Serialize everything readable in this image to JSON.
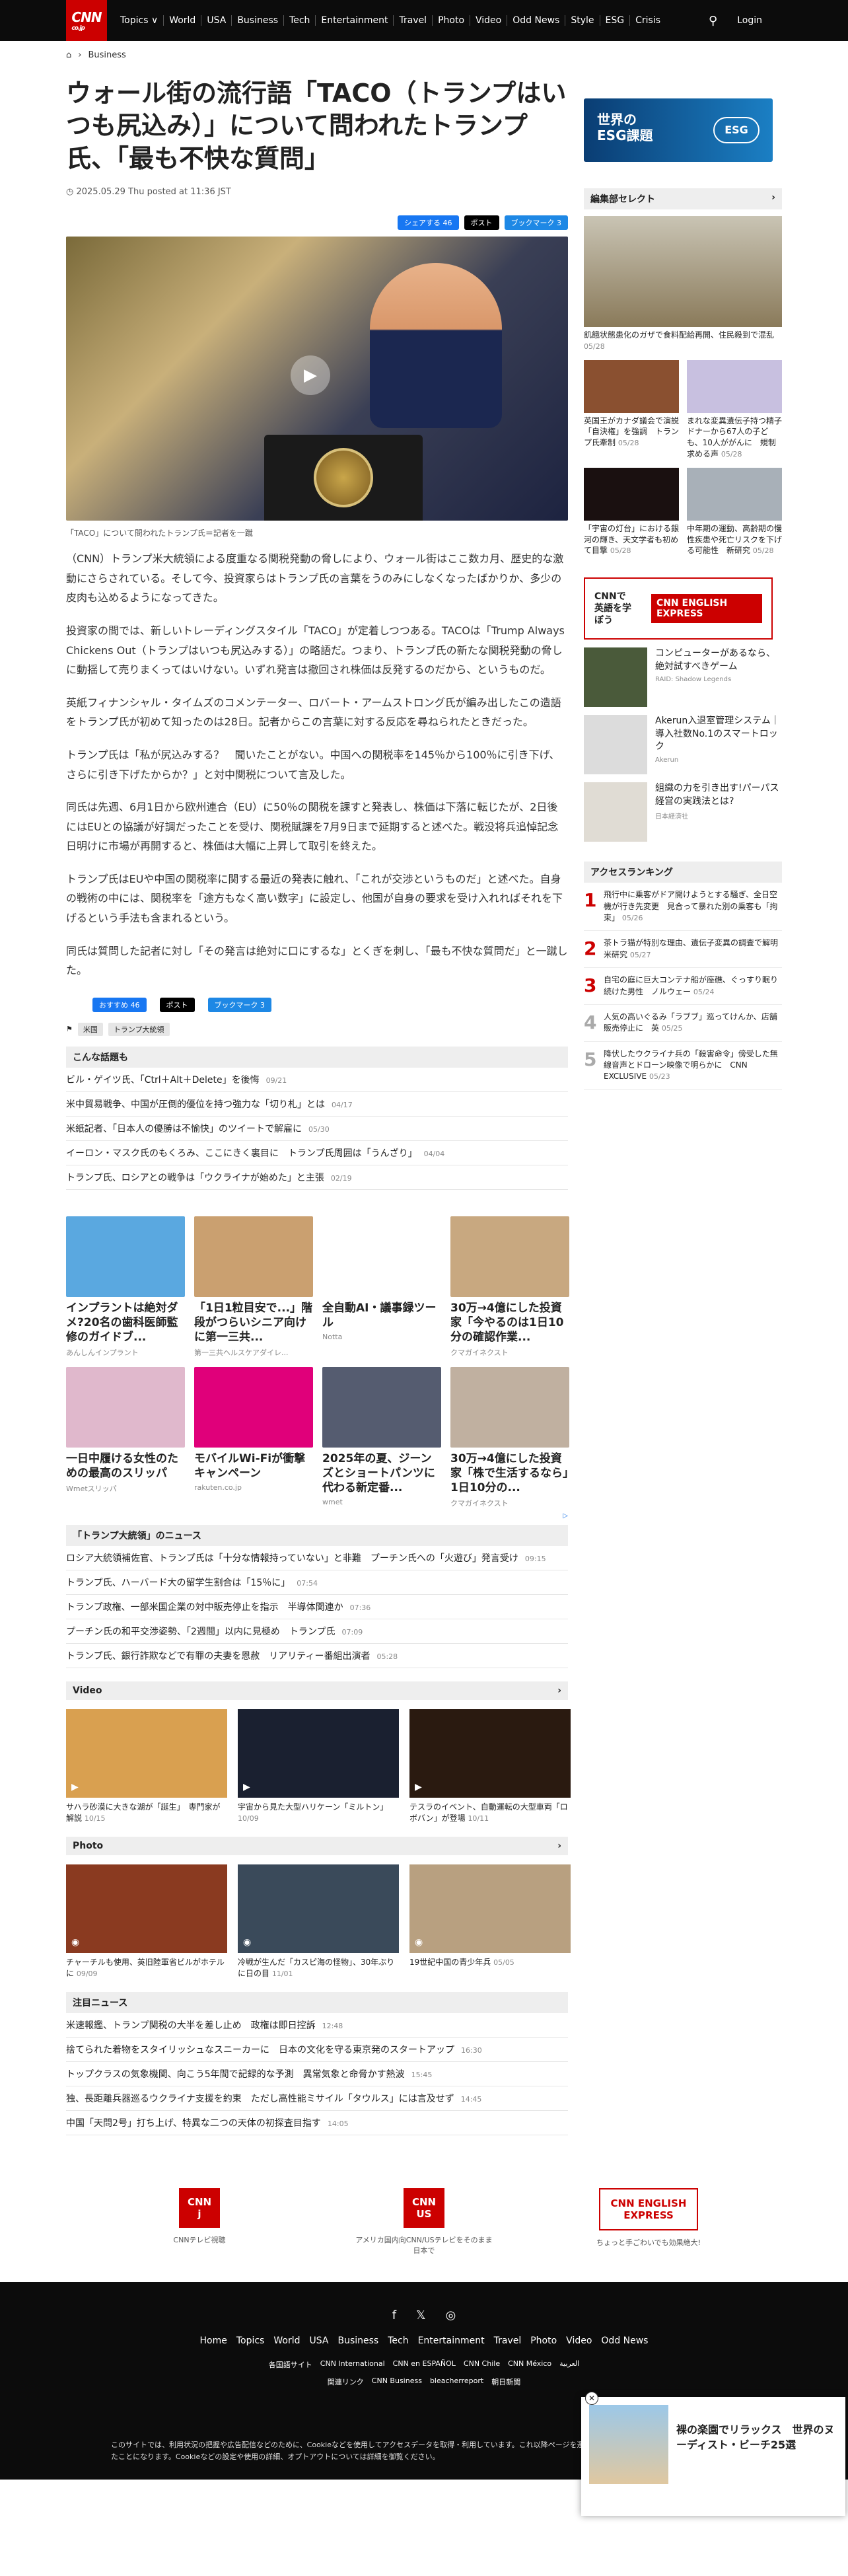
{
  "header": {
    "logo": "CNN",
    "logo_sub": "co.jp",
    "nav": [
      "Topics ∨",
      "World",
      "USA",
      "Business",
      "Tech",
      "Entertainment",
      "Travel",
      "Photo",
      "Video",
      "Odd News",
      "Style",
      "ESG",
      "Crisis"
    ],
    "login": "Login"
  },
  "breadcrumb": {
    "home": "⌂",
    "sep": "›",
    "section": "Business"
  },
  "article": {
    "title": "ウォール街の流行語「TACO（トランプはいつも尻込み）」について問われたトランプ氏、「最も不快な質問」",
    "date": "2025.05.29 Thu posted at 11:36 JST",
    "share": {
      "fb": "シェアする 46",
      "x": "ポスト",
      "hb": "ブックマーク 3"
    },
    "caption": "「TACO」について問われたトランプ氏＝記者を一蹴",
    "paragraphs": [
      "（CNN）トランプ米大統領による度重なる関税発動の脅しにより、ウォール街はここ数カ月、歴史的な激動にさらされている。そして今、投資家らはトランプ氏の言葉をうのみにしなくなったばかりか、多少の皮肉も込めるようになってきた。",
      "投資家の間では、新しいトレーディングスタイル「TACO」が定着しつつある。TACOは「Trump Always Chickens Out（トランプはいつも尻込みする）」の略語だ。つまり、トランプ氏の新たな関税発動の脅しに動揺して売りまくってはいけない。いずれ発言は撤回され株価は反発するのだから、というものだ。",
      "英紙フィナンシャル・タイムズのコメンテーター、ロバート・アームストロング氏が編み出したこの造語をトランプ氏が初めて知ったのは28日。記者からこの言葉に対する反応を尋ねられたときだった。",
      "トランプ氏は「私が尻込みする？　聞いたことがない。中国への関税率を145％から100％に引き下げ、さらに引き下げたからか？」と対中関税について言及した。",
      "同氏は先週、6月1日から欧州連合（EU）に50％の関税を課すと発表し、株価は下落に転じたが、2日後にはEUとの協議が好調だったことを受け、関税賦課を7月9日まで延期すると述べた。戦没将兵追悼記念日明けに市場が再開すると、株価は大幅に上昇して取引を終えた。",
      "トランプ氏はEUや中国の関税率に関する最近の発表に触れ、「これが交渉というものだ」と述べた。自身の戦術の中には、関税率を「途方もなく高い数字」に設定し、他国が自身の要求を受け入れればそれを下げるという手法も含まれるという。",
      "同氏は質問した記者に対し「その発言は絶対に口にするな」とくぎを刺し、「最も不快な質問だ」と一蹴した。"
    ],
    "share_bottom": {
      "fb": "おすすめ 46",
      "x": "ポスト",
      "hb": "ブックマーク 3"
    },
    "tags": [
      "米国",
      "トランプ大統領"
    ]
  },
  "related": {
    "heading": "こんな話題も",
    "items": [
      {
        "t": "ビル・ゲイツ氏、「Ctrl＋Alt＋Delete」を後悔",
        "d": "09/21"
      },
      {
        "t": "米中貿易戦争、中国が圧倒的優位を持つ強力な「切り札」とは",
        "d": "04/17"
      },
      {
        "t": "米紙記者、「日本人の優勝は不愉快」のツイートで解雇に",
        "d": "05/30"
      },
      {
        "t": "イーロン・マスク氏のもくろみ、ここにきく裏目に　トランプ氏周囲は「うんざり」",
        "d": "04/04"
      },
      {
        "t": "トランプ氏、ロシアとの戦争は「ウクライナが始めた」と主張",
        "d": "02/19"
      }
    ]
  },
  "ads": [
    {
      "t": "インプラントは絶対ダメ?20名の歯科医師監修のガイドブ...",
      "s": "あんしんインプラント",
      "c": "#5aa8e0"
    },
    {
      "t": "「1日1粒目安で...」階段がつらいシニア向けに第一三共...",
      "s": "第一三共ヘルスケアダイレ...",
      "c": "#caa070"
    },
    {
      "t": "全自動AI・議事録ツール",
      "s": "Notta",
      "c": "#ffffff"
    },
    {
      "t": "30万→4億にした投資家「今やるのは1日10分の確認作業...",
      "s": "クマガイネクスト",
      "c": "#c8a880"
    },
    {
      "t": "一日中履ける女性のための最高のスリッパ",
      "s": "Wmetスリッパ",
      "c": "#e0b8cc"
    },
    {
      "t": "モバイルWi-Fiが衝撃キャンペーン",
      "s": "rakuten.co.jp",
      "c": "#e0007a"
    },
    {
      "t": "2025年の夏、ジーンズとショートパンツに代わる新定番...",
      "s": "wmet",
      "c": "#555c70"
    },
    {
      "t": "30万→4億にした投資家「株で生活するなら」1日10分の...",
      "s": "クマガイネクスト",
      "c": "#c0b0a0"
    }
  ],
  "trump_tariffs": {
    "heading": "「トランプ大統領」のニュース",
    "items": [
      {
        "t": "ロシア大統領補佐官、トランプ氏は「十分な情報持っていない」と非難　プーチン氏への「火遊び」発言受け",
        "d": "09:15"
      },
      {
        "t": "トランプ氏、ハーバード大の留学生割合は「15％に」",
        "d": "07:54"
      },
      {
        "t": "トランプ政権、一部米国企業の対中販売停止を指示　半導体関連か",
        "d": "07:36"
      },
      {
        "t": "プーチン氏の和平交渉姿勢、「2週間」以内に見極め　トランプ氏",
        "d": "07:09"
      },
      {
        "t": "トランプ氏、銀行詐欺などで有罪の夫妻を恩赦　リアリティー番組出演者",
        "d": "05:28"
      }
    ]
  },
  "video": {
    "heading": "Video",
    "items": [
      {
        "t": "サハラ砂漠に大きな湖が「誕生」　専門家が解説",
        "d": "10/15",
        "c": "#d9a050"
      },
      {
        "t": "宇宙から見た大型ハリケーン「ミルトン」",
        "d": "10/09",
        "c": "#1a2030"
      },
      {
        "t": "テスラのイベント、自動運転の大型車両「ロボバン」が登場",
        "d": "10/11",
        "c": "#2a1a10"
      }
    ]
  },
  "photo": {
    "heading": "Photo",
    "items": [
      {
        "t": "チャーチルも使用、英旧陸軍省ビルがホテルに",
        "d": "09/09",
        "c": "#8a3a20"
      },
      {
        "t": "冷戦が生んだ「カスピ海の怪物」、30年ぶりに日の目",
        "d": "11/01",
        "c": "#3a4a5a"
      },
      {
        "t": "19世紀中国の青少年兵",
        "d": "05/05",
        "c": "#b8a080"
      }
    ]
  },
  "featured": {
    "heading": "注目ニュース",
    "items": [
      {
        "t": "米速報鑑、トランプ関税の大半を差し止め　政権は即日控訴",
        "d": "12:48"
      },
      {
        "t": "捨てられた着物をスタイリッシュなスニーカーに　日本の文化を守る東京発のスタートアップ",
        "d": "16:30"
      },
      {
        "t": "トップクラスの気象機関、向こう5年間で記録的な予測　異常気象と命脅かす熱波",
        "d": "15:45"
      },
      {
        "t": "独、長距離兵器巡るウクライナ支援を約束　ただし高性能ミサイル「タウルス」には言及せず",
        "d": "14:45"
      },
      {
        "t": "中国「天問2号」打ち上げ、特異な二つの天体の初探査目指す",
        "d": "14:05"
      }
    ]
  },
  "sidebar": {
    "esg_ad": "世界の\nESG課題",
    "esg_badge": "ESG",
    "editors_heading": "編集部セレクト",
    "big": {
      "t": "飢餓状態患化のガザで食料配給再開、住民殺到で混乱",
      "d": "05/28"
    },
    "pairs": [
      [
        {
          "t": "英国王がカナダ議会で演説「自決権」を強調　トランプ氏牽制",
          "d": "05/28",
          "c": "#8a5030"
        },
        {
          "t": "まれな変異遺伝子持つ精子ドナーから67人の子ども、10人ががんに　規制求める声",
          "d": "05/28",
          "c": "#c8c0e0"
        }
      ],
      [
        {
          "t": "「宇宙の灯台」における銀河の輝き、天文学者も初めて目撃",
          "d": "05/28",
          "c": "#1a1010"
        },
        {
          "t": "中年期の運動、高齢期の慢性疾患や死亡リスクを下げる可能性　新研究",
          "d": "05/28",
          "c": "#a8b0b8"
        }
      ]
    ],
    "english_ad": {
      "l": "CNNで\n英語を学ぼう",
      "r": "CNN ENGLISH EXPRESS"
    },
    "sponsored": [
      {
        "t": "コンピューターがあるなら、絶対試すべきゲーム",
        "s": "RAID: Shadow Legends",
        "c": "#4a5a3a"
      },
      {
        "t": "Akerun入退室管理システム｜導入社数No.1のスマートロック",
        "s": "Akerun",
        "c": "#dcdcdc"
      },
      {
        "t": "組織の力を引き出す!パーパス経営の実践法とは?",
        "s": "日本経済社",
        "c": "#e0dcd4"
      }
    ],
    "ranking_heading": "アクセスランキング",
    "ranking": [
      {
        "n": "1",
        "t": "飛行中に乗客がドア開けようとする騒ぎ、全日空機が行き先変更　見合って暴れた別の乗客も「拘束」",
        "d": "05/26"
      },
      {
        "n": "2",
        "t": "茶トラ猫が特別な理由、遺伝子変異の調査で解明　米研究",
        "d": "05/27"
      },
      {
        "n": "3",
        "t": "自宅の庭に巨大コンテナ船が座礁、ぐっすり眠り続けた男性　ノルウェー",
        "d": "05/24"
      },
      {
        "n": "4",
        "t": "人気の高いぐるみ「ラブブ」巡ってけんか、店舗販売停止に　英",
        "d": "05/25"
      },
      {
        "n": "5",
        "t": "降伏したウクライナ兵の「殺害命令」傍受した無線音声とドローン映像で明らかに　CNN EXCLUSIVE",
        "d": "05/23"
      }
    ]
  },
  "footer_ads": [
    {
      "m": "CNN j",
      "t": "CNNテレビ視聴"
    },
    {
      "m": "CNN US",
      "t": "アメリカ国内向CNN/USテレビをそのまま日本で"
    },
    {
      "m": "CNN ENGLISH EXPRESS",
      "t": "ちょっと手ごわいでも効果絶大!"
    }
  ],
  "footer": {
    "social": [
      "f",
      "𝕏",
      "◎"
    ],
    "nav": [
      "Home",
      "Topics",
      "World",
      "USA",
      "Business",
      "Tech",
      "Entertainment",
      "Travel",
      "Photo",
      "Video",
      "Odd News"
    ],
    "links1": [
      "各国語サイト",
      "CNN International",
      "CNN en ESPAÑOL",
      "CNN Chile",
      "CNN México",
      "العربية"
    ],
    "links2": [
      "関連リンク",
      "CNN Business",
      "bleacherreport",
      "朝日新聞"
    ],
    "cookie": "このサイトでは、利用状況の把握や広告配信などのために、Cookieなどを使用してアクセスデータを取得・利用しています。これ以降ページを遷移した場合、Cookieなどの設定や使用に同意したことになります。Cookieなどの設定や使用の詳細、オプトアウトについては詳細を御覧ください。",
    "close": "✕"
  },
  "popup": {
    "t": "裸の楽園でリラックス　世界のヌーディスト・ビーチ25選",
    "close": "✕"
  }
}
